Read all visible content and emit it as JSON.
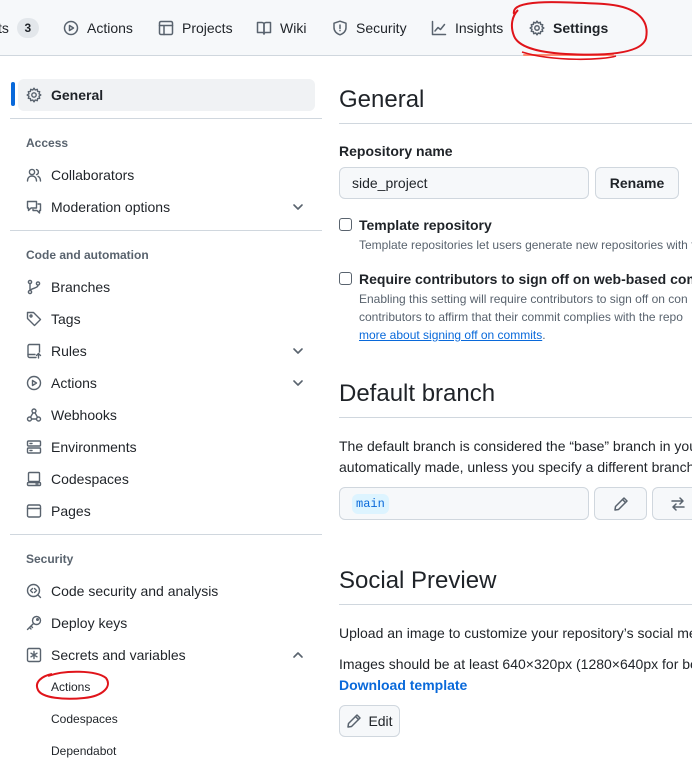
{
  "nav": {
    "tabs": [
      {
        "label": "ts",
        "counter": "3",
        "icon": "issue-icon"
      },
      {
        "label": "Actions",
        "icon": "play-icon"
      },
      {
        "label": "Projects",
        "icon": "table-icon"
      },
      {
        "label": "Wiki",
        "icon": "book-icon"
      },
      {
        "label": "Security",
        "icon": "shield-icon"
      },
      {
        "label": "Insights",
        "icon": "graph-icon"
      },
      {
        "label": "Settings",
        "icon": "gear-icon",
        "selected": true
      }
    ]
  },
  "sidebar": {
    "general": "General",
    "sections": [
      {
        "heading": "Access",
        "items": [
          "Collaborators",
          "Moderation options"
        ]
      },
      {
        "heading": "Code and automation",
        "items": [
          "Branches",
          "Tags",
          "Rules",
          "Actions",
          "Webhooks",
          "Environments",
          "Codespaces",
          "Pages"
        ]
      },
      {
        "heading": "Security",
        "items": [
          "Code security and analysis",
          "Deploy keys",
          "Secrets and variables"
        ]
      }
    ],
    "secrets_subitems": [
      "Actions",
      "Codespaces",
      "Dependabot"
    ]
  },
  "general": {
    "title": "General",
    "repo_name_label": "Repository name",
    "repo_name_value": "side_project",
    "rename_button": "Rename",
    "template_label": "Template repository",
    "template_note": "Template repositories let users generate new repositories with t",
    "signoff_label": "Require contributors to sign off on web-based comm",
    "signoff_note_1": "Enabling this setting will require contributors to sign off on con",
    "signoff_note_2": "contributors to affirm that their commit complies with the repo",
    "signoff_link": "more about signing off on commits",
    "signoff_period": "."
  },
  "default_branch": {
    "title": "Default branch",
    "desc_1": "The default branch is considered the “base” branch in you",
    "desc_2": "automatically made, unless you specify a different branch",
    "branch": "main"
  },
  "social_preview": {
    "title": "Social Preview",
    "desc_1": "Upload an image to customize your repository’s social me",
    "desc_2": "Images should be at least 640×320px (1280×640px for be",
    "download_link": "Download template",
    "edit_button": "Edit"
  },
  "colors": {
    "accent": "#0969da",
    "annotation": "#e0141a",
    "tab_underline": "#fd8c73"
  }
}
